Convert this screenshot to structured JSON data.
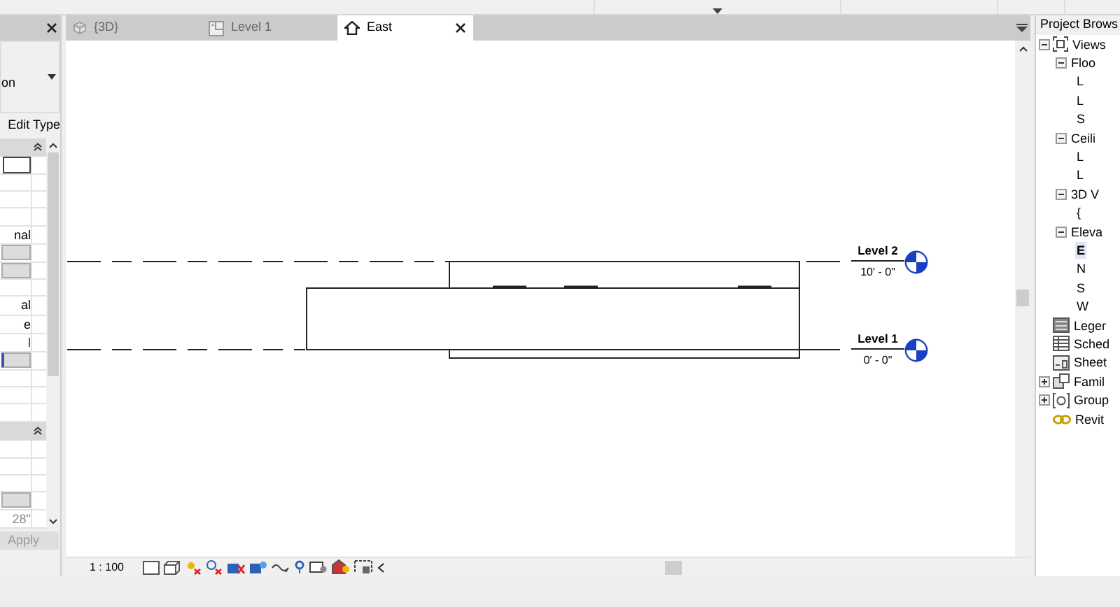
{
  "properties": {
    "type_selector": "on",
    "edit_type": "Edit Type",
    "rows": [
      {
        "kind": "field"
      },
      {
        "kind": "blank"
      },
      {
        "kind": "blank"
      },
      {
        "kind": "blank"
      },
      {
        "kind": "text",
        "text": "nal"
      },
      {
        "kind": "button"
      },
      {
        "kind": "button"
      },
      {
        "kind": "blank"
      },
      {
        "kind": "text",
        "text": "al"
      },
      {
        "kind": "text",
        "text": "e"
      },
      {
        "kind": "link",
        "text": "l"
      },
      {
        "kind": "link_button"
      },
      {
        "kind": "blank"
      },
      {
        "kind": "blank"
      },
      {
        "kind": "blank"
      },
      {
        "kind": "header"
      },
      {
        "kind": "blank"
      },
      {
        "kind": "blank"
      },
      {
        "kind": "blank"
      },
      {
        "kind": "button"
      },
      {
        "kind": "muted",
        "text": "28\""
      }
    ],
    "apply": {
      "label": "Apply",
      "disabled": true
    }
  },
  "tabs": [
    {
      "label": "{3D}",
      "kind": "model",
      "selected": false
    },
    {
      "label": "Level 1",
      "kind": "plan",
      "selected": false
    },
    {
      "label": "East",
      "kind": "elevation",
      "selected": true
    }
  ],
  "canvas": {
    "levels": [
      {
        "name": "Level 2",
        "elevation": "10' - 0\""
      },
      {
        "name": "Level 1",
        "elevation": "0' - 0\""
      }
    ]
  },
  "status_bar": {
    "scale": "1 : 100"
  },
  "browser": {
    "title": "Project Brows",
    "tree": [
      {
        "label": "Views",
        "kind": "views",
        "expanded": true,
        "selected": false,
        "children": [
          {
            "label": "Floo",
            "expanded": true,
            "selected": false,
            "children": [
              {
                "label": "L",
                "selected": false
              },
              {
                "label": "L",
                "selected": false
              },
              {
                "label": "S",
                "selected": false
              }
            ]
          },
          {
            "label": "Ceili",
            "expanded": true,
            "selected": false,
            "children": [
              {
                "label": "L",
                "selected": false
              },
              {
                "label": "L",
                "selected": false
              }
            ]
          },
          {
            "label": "3D V",
            "expanded": true,
            "selected": false,
            "children": [
              {
                "label": "{",
                "selected": false
              }
            ]
          },
          {
            "label": "Eleva",
            "expanded": true,
            "selected": false,
            "children": [
              {
                "label": "E",
                "selected": true
              },
              {
                "label": "N",
                "selected": false
              },
              {
                "label": "S",
                "selected": false
              },
              {
                "label": "W",
                "selected": false
              }
            ]
          }
        ]
      },
      {
        "label": "Leger",
        "kind": "legends",
        "selected": false
      },
      {
        "label": "Sched",
        "kind": "schedules",
        "selected": false
      },
      {
        "label": "Sheet",
        "kind": "sheets",
        "selected": false
      },
      {
        "label": "Famil",
        "kind": "families",
        "expanded": false,
        "selected": false
      },
      {
        "label": "Group",
        "kind": "groups",
        "expanded": false,
        "selected": false
      },
      {
        "label": "Revit",
        "kind": "links",
        "selected": false
      }
    ]
  }
}
